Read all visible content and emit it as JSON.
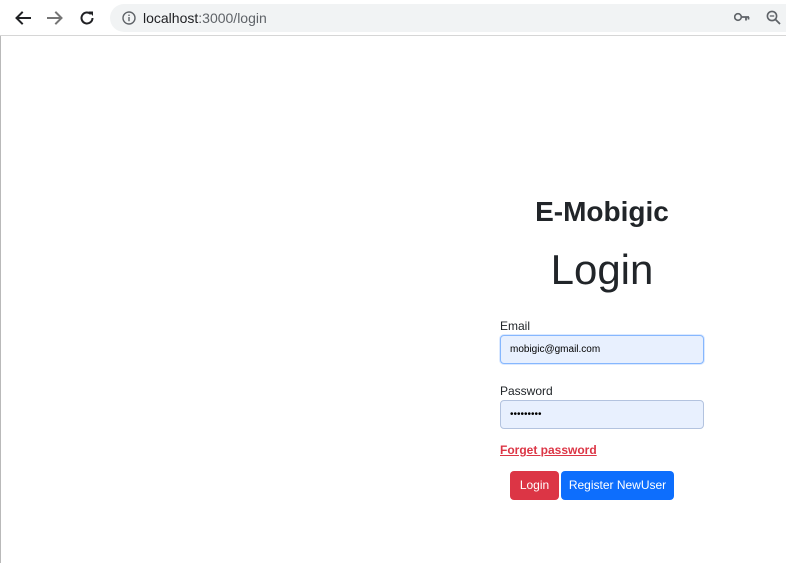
{
  "browser": {
    "url_host": "localhost",
    "url_path": ":3000/login"
  },
  "page": {
    "brand": "E-Mobigic",
    "heading": "Login"
  },
  "form": {
    "email_label": "Email",
    "email_value": "mobigic@gmail.com",
    "password_label": "Password",
    "password_value": "•••••••••",
    "forgot_label": "Forget password",
    "login_label": "Login",
    "register_label": "Register NewUser"
  },
  "colors": {
    "primary": "#0d6efd",
    "danger": "#dc3545",
    "autofill_bg": "#e8f0fe"
  },
  "icons": [
    "back-arrow-icon",
    "forward-arrow-icon",
    "reload-icon",
    "info-icon",
    "key-icon",
    "zoom-icon"
  ]
}
